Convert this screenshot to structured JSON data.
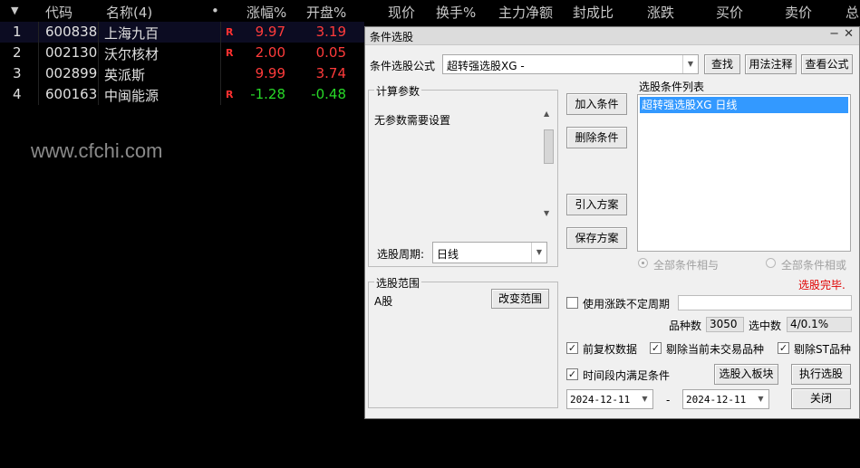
{
  "table": {
    "sort_arrow": "▼",
    "headers": [
      "代码",
      "名称(4)",
      "•",
      "涨幅%",
      "开盘%",
      "现价",
      "换手%",
      "主力净额",
      "封成比",
      "涨跌",
      "买价",
      "卖价",
      "总"
    ],
    "rows": [
      {
        "idx": "1",
        "code": "600838",
        "name": "上海九百",
        "flag": "R",
        "chg": "9.97",
        "open": "3.19"
      },
      {
        "idx": "2",
        "code": "002130",
        "name": "沃尔核材",
        "flag": "R",
        "chg": "2.00",
        "open": "0.05"
      },
      {
        "idx": "3",
        "code": "002899",
        "name": "英派斯",
        "flag": "",
        "chg": "9.99",
        "open": "3.74"
      },
      {
        "idx": "4",
        "code": "600163",
        "name": "中闽能源",
        "flag": "R",
        "chg": "-1.28",
        "open": "-0.48"
      }
    ]
  },
  "watermark": "www.cfchi.com",
  "dialog": {
    "title": "条件选股",
    "minimize": "−",
    "close": "✕",
    "formula_label": "条件选股公式",
    "formula_value": "超转强选股XG  -",
    "find_button": "查找",
    "usage_button": "用法注释",
    "view_formula_button": "查看公式",
    "params_group": "计算参数",
    "params_text": "无参数需要设置",
    "period_label": "选股周期:",
    "period_value": "日线",
    "add_condition": "加入条件",
    "delete_condition": "删除条件",
    "import_plan": "引入方案",
    "save_plan": "保存方案",
    "list_title": "选股条件列表",
    "list_items": [
      "超转强选股XG  日线"
    ],
    "radio_and": "全部条件相与",
    "radio_or": "全部条件相或",
    "status": "选股完毕.",
    "scope_group": "选股范围",
    "scope_value": "A股",
    "change_scope": "改变范围",
    "use_volatility": "使用涨跌不定周期",
    "count_label": "品种数",
    "count_value": "3050",
    "selected_label": "选中数",
    "selected_value": "4/0.1%",
    "fq_data": "前复权数据",
    "exclude_untraded": "剔除当前未交易品种",
    "exclude_st": "剔除ST品种",
    "time_condition": "时间段内满足条件",
    "to_board": "选股入板块",
    "execute": "执行选股",
    "date_from": "2024-12-11",
    "date_sep": "-",
    "date_to": "2024-12-11",
    "close_button": "关闭"
  },
  "colors": {
    "up": "#ff3b3b",
    "down": "#28d828",
    "selection": "#3399ff"
  }
}
